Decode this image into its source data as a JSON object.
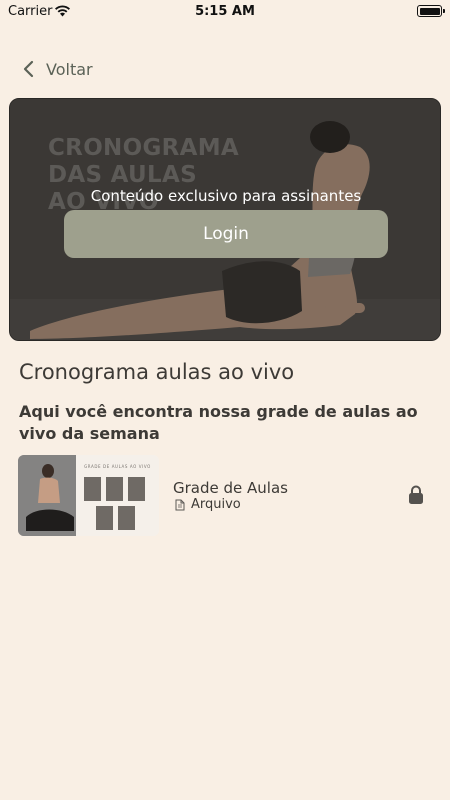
{
  "status_bar": {
    "carrier": "Carrier",
    "time": "5:15 AM"
  },
  "nav": {
    "back_label": "Voltar"
  },
  "hero": {
    "background_title_lines": [
      "CRONOGRAMA",
      "DAS AULAS",
      "AO VIVO"
    ],
    "message": "Conteúdo exclusivo para assinantes",
    "login_label": "Login"
  },
  "section": {
    "title": "Cronograma aulas ao vivo",
    "subtitle": "Aqui você encontra nossa grade de aulas ao vivo da semana"
  },
  "items": [
    {
      "title": "Grade de Aulas",
      "type": "Arquivo",
      "thumb_heading": "GRADE DE AULAS AO VIVO",
      "icon": "file-icon",
      "status_icon": "lock-icon"
    }
  ],
  "colors": {
    "background": "#f9efe4",
    "accent_button": "#9ea08d",
    "text_primary": "#3d3a36",
    "back_text": "#5b6257"
  }
}
